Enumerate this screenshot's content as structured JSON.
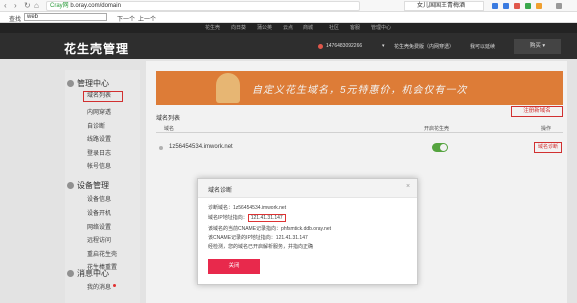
{
  "browser": {
    "url_prefix": "Cray网",
    "url": "b.oray.com/domain",
    "search_value": "女儿国国王青梅酒",
    "accent": "#2a9a3a"
  },
  "find_bar": {
    "label": "查找",
    "value": "web",
    "next": "下一个",
    "prev": "上一个"
  },
  "top_nav": [
    "花生壳",
    "向日葵",
    "蒲公英",
    "云点",
    "商城",
    "社区",
    "客服",
    "管理中心"
  ],
  "header": {
    "logo": "花生壳管理",
    "account": "1476483092266",
    "service": "花生壳免费版（内网穿透）",
    "upgrade": "我可以延续",
    "buy": "购买"
  },
  "sidebar": {
    "sections": [
      {
        "title": "管理中心",
        "items": [
          "域名列表",
          "内网穿透",
          "自诊断",
          "线路设置",
          "登录日志",
          "帐号信息"
        ]
      },
      {
        "title": "设备管理",
        "items": [
          "设备信息",
          "设备开机",
          "网络设置",
          "远程访问",
          "重启花生壳",
          "花生棒重置"
        ]
      },
      {
        "title": "消息中心",
        "items": [
          "我的消息"
        ]
      }
    ],
    "active_item": "域名列表"
  },
  "main": {
    "banner_text": "自定义花生域名，5元特惠价，机会仅有一次",
    "list_title": "域名列表",
    "register_button": "注册新域名",
    "columns": [
      "域名",
      "开启花生壳",
      "操作"
    ],
    "rows": [
      {
        "domain": "1z56454534.imwork.net",
        "enabled": true,
        "action": "域名诊断"
      }
    ]
  },
  "dialog": {
    "title": "域名诊断",
    "close": "×",
    "lines": [
      "诊断域名：1z56454534.imwork.net",
      "域名IP地址指向：",
      "该域名的当前CNAME记录指向：phfsmtick.ddb.oray.net",
      "该CNAME记录的IP地址指向：121.41.31.147",
      "经检测，您的域名已开启解析服务，并指向正确"
    ],
    "ip": "121.41.31.147",
    "button": "关闭",
    "button_color": "#e8294c"
  }
}
